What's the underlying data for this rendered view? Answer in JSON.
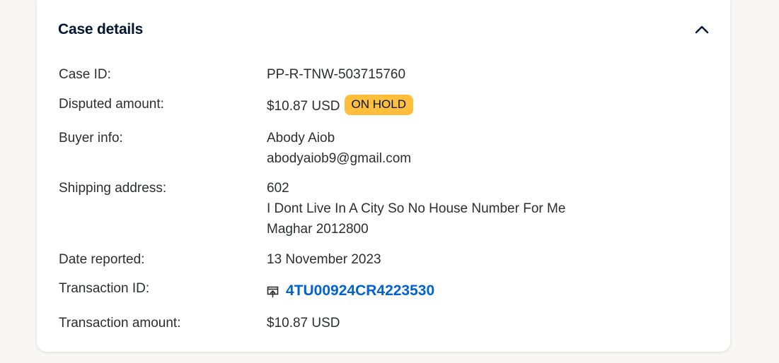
{
  "card": {
    "title": "Case details",
    "collapse_icon": "chevron-up-icon"
  },
  "details": {
    "case_id": {
      "label": "Case ID:",
      "value": "PP-R-TNW-503715760"
    },
    "disputed_amount": {
      "label": "Disputed amount:",
      "value": "$10.87 USD",
      "badge": "ON HOLD",
      "badge_color": "#ffbf3d"
    },
    "buyer_info": {
      "label": "Buyer info:",
      "name": "Abody Aiob",
      "email": "abodyaiob9@gmail.com"
    },
    "shipping_address": {
      "label": "Shipping address:",
      "line1": "602",
      "line2": "I Dont Live In A City So No House Number For Me",
      "line3": "Maghar 2012800"
    },
    "date_reported": {
      "label": "Date reported:",
      "value": "13 November 2023"
    },
    "transaction_id": {
      "label": "Transaction ID:",
      "value": "4TU00924CR4223530",
      "icon": "external-link-icon",
      "link_color": "#0063d1"
    },
    "transaction_amount": {
      "label": "Transaction amount:",
      "value": "$10.87 USD"
    }
  }
}
